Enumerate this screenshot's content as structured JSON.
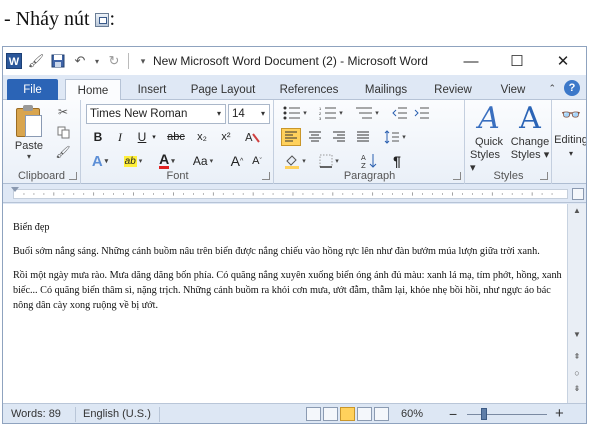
{
  "caption": {
    "text": "- Nháy nút",
    "colon": ":"
  },
  "window": {
    "title": "New Microsoft Word Document (2)  -  Microsoft Word",
    "app_icon_letter": "W",
    "controls": {
      "minimize": "—",
      "maximize": "☐",
      "close": "✕"
    }
  },
  "tabs": [
    "File",
    "Home",
    "Insert",
    "Page Layout",
    "References",
    "Mailings",
    "Review",
    "View"
  ],
  "active_tab": "Home",
  "ribbon": {
    "clipboard": {
      "label": "Clipboard",
      "paste": "Paste"
    },
    "font": {
      "label": "Font",
      "font_name": "Times New Roman",
      "font_size": "14",
      "bold": "B",
      "italic": "I",
      "underline": "U",
      "strike": "abc",
      "subscript": "x₂",
      "superscript": "x²",
      "grow": "A",
      "shrink": "A",
      "change_case": "Aa",
      "highlight": "ab",
      "font_color": "A"
    },
    "paragraph": {
      "label": "Paragraph",
      "pilcrow": "¶"
    },
    "styles": {
      "label": "Styles",
      "quick": "Quick",
      "quick2": "Styles",
      "change": "Change",
      "change2": "Styles"
    },
    "editing": {
      "label": "Editing"
    }
  },
  "document": {
    "title": "Biển đẹp",
    "paragraphs": [
      "Buổi sớm nắng sáng. Những cánh buồm nâu trên biển được nắng chiếu vào hồng rực lên như đàn bướm múa lượn giữa trời xanh.",
      "Rồi một ngày mưa rào. Mưa dăng dăng bốn phía. Có quãng nắng xuyên xuống biển óng ánh đủ màu: xanh lá mạ, tím phớt, hồng, xanh biếc... Có quãng biển thâm sì, nặng trịch. Những cánh buồm ra khỏi cơn mưa, ướt đẫm, thẫm lại, khỏe nhẹ bồi hồi, như ngực áo bác nông dân cày xong ruộng về bị ướt."
    ]
  },
  "status": {
    "words": "Words: 89",
    "language": "English (U.S.)",
    "zoom": "60%",
    "zoom_minus": "−",
    "zoom_plus": "+"
  },
  "colors": {
    "file_tab": "#2b64b6",
    "frame": "#dfe8f5",
    "highlight": "#ffd15c"
  }
}
